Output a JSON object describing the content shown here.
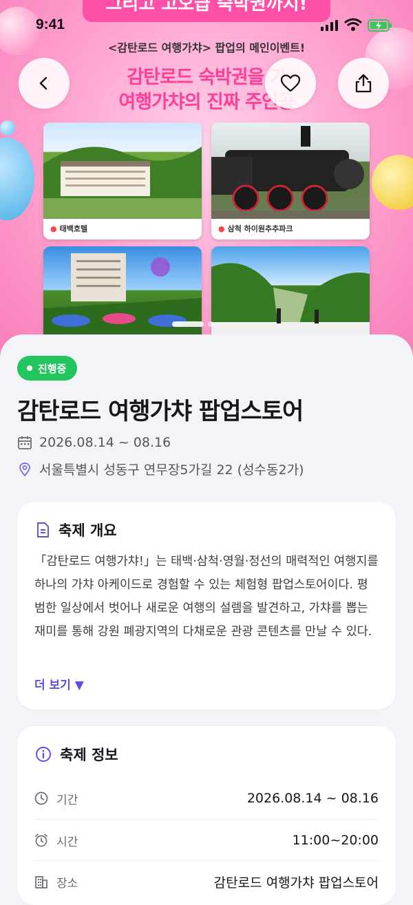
{
  "status_bar": {
    "time": "9:41"
  },
  "poster": {
    "banner": "그리고 고오급 숙박권까지!",
    "subtitle": "<감탄로드 여행가챠> 팝업의 메인이벤트!",
    "headline_line1": "감탄로드 숙박권을 가",
    "headline_line2": "여행가챠의 진짜 주인공",
    "photos": [
      {
        "caption": "태백호텔"
      },
      {
        "caption": "삼척 하이원추추파크"
      },
      {
        "caption": ""
      },
      {
        "caption": ""
      }
    ]
  },
  "nav": {
    "back": "back-icon",
    "like": "heart-icon",
    "share": "share-icon"
  },
  "status_badge": "진행중",
  "title": "감탄로드 여행가챠 팝업스토어",
  "date_range": "2026.08.14 ~ 08.16",
  "address": "서울특별시 성동구 연무장5가길 22 (성수동2가)",
  "overview": {
    "heading": "축제 개요",
    "body": "「감탄로드 여행가챠!」는 태백·삼척·영월·정선의 매력적인 여행지를 하나의 가챠 아케이드로 경험할 수 있는 체험형 팝업스토어이다. 평범한 일상에서 벗어나 새로운 여행의 설렘을 발견하고, 가챠를 뽑는 재미를 통해 강원 폐광지역의 다채로운 관광 콘텐츠를 만날 수 있다.",
    "more_label": "더 보기 ▼"
  },
  "info": {
    "heading": "축제 정보",
    "rows": [
      {
        "label": "기간",
        "value": "2026.08.14 ~ 08.16",
        "icon": "clock-icon"
      },
      {
        "label": "시간",
        "value": "11:00~20:00",
        "icon": "alarm-icon"
      },
      {
        "label": "장소",
        "value": "감탄로드 여행가챠 팝업스토어",
        "icon": "building-icon"
      }
    ]
  },
  "colors": {
    "accent": "#5a4de6",
    "badge": "#22c55e",
    "poster_pink": "#ff3f97"
  }
}
